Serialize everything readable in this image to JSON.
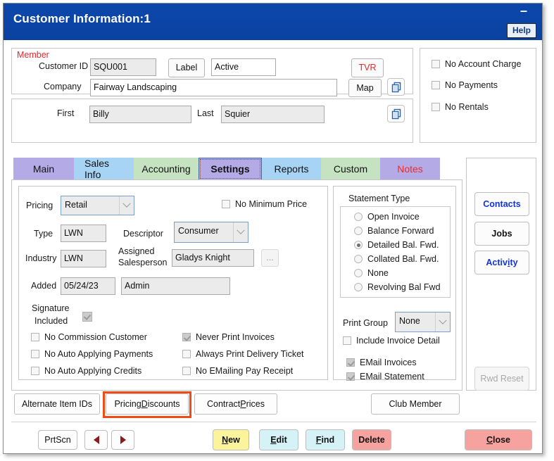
{
  "window": {
    "title": "Customer Information:1",
    "minimize_label": "–",
    "help_label": "Help"
  },
  "header": {
    "member_label": "Member",
    "customer_id_label": "Customer ID",
    "customer_id_value": "SQU001",
    "label_button": "Label",
    "status_value": "Active",
    "tvr_button": "TVR",
    "company_label": "Company",
    "company_value": "Fairway Landscaping",
    "map_button": "Map",
    "copy_company_icon": "copy-icon",
    "first_label": "First",
    "first_value": "Billy",
    "last_label": "Last",
    "last_value": "Squier",
    "copy_name_icon": "copy-icon",
    "flags": [
      {
        "label": "No Account Charge",
        "checked": false
      },
      {
        "label": "No Payments",
        "checked": false
      },
      {
        "label": "No Rentals",
        "checked": false
      }
    ]
  },
  "tabs": [
    {
      "label": "Main",
      "color": "purple",
      "active": false
    },
    {
      "label": "Sales Info",
      "color": "blue",
      "active": false
    },
    {
      "label": "Accounting",
      "color": "green",
      "active": false
    },
    {
      "label": "Settings",
      "color": "purple",
      "active": true
    },
    {
      "label": "Reports",
      "color": "blue",
      "active": false
    },
    {
      "label": "Custom",
      "color": "green",
      "active": false
    },
    {
      "label": "Notes",
      "color": "purple",
      "active": false
    }
  ],
  "settings": {
    "pricing_label": "Pricing",
    "pricing_value": "Retail",
    "no_minimum_price_label": "No Minimum Price",
    "no_minimum_price_checked": false,
    "type_label": "Type",
    "type_value": "LWN",
    "descriptor_label": "Descriptor",
    "descriptor_value": "Consumer",
    "industry_label": "Industry",
    "industry_value": "LWN",
    "assigned_salesperson_label_1": "Assigned",
    "assigned_salesperson_label_2": "Salesperson",
    "assigned_salesperson_value": "Gladys Knight",
    "salesperson_browse_button": "...",
    "added_label": "Added",
    "added_value": "05/24/23",
    "added_by_value": "Admin",
    "signature_label_1": "Signature",
    "signature_label_2": "Included",
    "signature_checked": true,
    "checkboxes_left": [
      {
        "label": "No Commission Customer",
        "checked": false
      },
      {
        "label": "No Auto Applying Payments",
        "checked": false
      },
      {
        "label": "No Auto Applying Credits",
        "checked": false
      }
    ],
    "checkboxes_right": [
      {
        "label": "Never Print Invoices",
        "checked": true
      },
      {
        "label": "Always Print Delivery Ticket",
        "checked": false
      },
      {
        "label": "No EMailing Pay Receipt",
        "checked": false
      }
    ]
  },
  "statement": {
    "group_title": "Statement Type",
    "options": [
      {
        "label": "Open Invoice",
        "selected": false
      },
      {
        "label": "Balance Forward",
        "selected": false
      },
      {
        "label": "Detailed Bal. Fwd.",
        "selected": true
      },
      {
        "label": "Collated Bal. Fwd.",
        "selected": false
      },
      {
        "label": "None",
        "selected": false
      },
      {
        "label": "Revolving Bal Fwd",
        "selected": false
      }
    ],
    "print_group_label": "Print Group",
    "print_group_value": "None",
    "include_invoice_detail_label": "Include Invoice Detail",
    "include_invoice_detail_checked": false,
    "email_invoices_label": "EMail Invoices",
    "email_invoices_checked": true,
    "email_statement_label": "EMail Statement",
    "email_statement_checked": true
  },
  "rail": {
    "contacts": "Contacts",
    "jobs": "Jobs",
    "activity_pre": "Activ",
    "activity_accel": "i",
    "activity_post": "ty",
    "rwd_reset": "Rwd Reset"
  },
  "actions": {
    "alternate_item_ids": "Alternate Item IDs",
    "pricing_discounts_pre": "Pricing ",
    "pricing_discounts_accel": "D",
    "pricing_discounts_post": "iscounts",
    "contract_prices_pre": "Contract ",
    "contract_prices_accel": "P",
    "contract_prices_post": "rices",
    "club_member": "Club Member"
  },
  "bottom": {
    "prtscn": "PrtScn",
    "prev_icon": "previous-arrow-icon",
    "next_icon": "next-arrow-icon",
    "new_pre": "",
    "new_accel": "N",
    "new_post": "ew",
    "edit_pre": "",
    "edit_accel": "E",
    "edit_post": "dit",
    "find_pre": "",
    "find_accel": "F",
    "find_post": "ind",
    "delete": "Delete",
    "close_pre": "",
    "close_accel": "C",
    "close_post": "lose"
  },
  "colors": {
    "titlebar": "#0b45a8",
    "accent_red": "#e8262c",
    "highlight": "#f04a16",
    "tab_purple": "#b3aae6",
    "tab_blue": "#a7d3f5",
    "tab_green": "#c5e3c0",
    "link_blue": "#1433d6"
  }
}
